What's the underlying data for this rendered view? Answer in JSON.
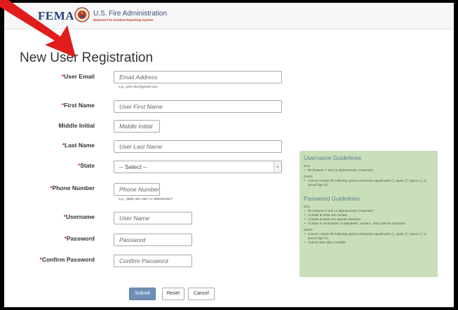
{
  "header": {
    "fema": "FEMA",
    "usfa_title": "U.S. Fire Administration",
    "usfa_sub": "National Fire Incident Reporting System"
  },
  "page_title": "New User Registration",
  "form": {
    "email": {
      "label": "User Email",
      "placeholder": "Email Address",
      "hint": "e.g., john.doe@gmail.com"
    },
    "first_name": {
      "label": "First Name",
      "placeholder": "User First Name"
    },
    "middle_initial": {
      "label": "Middle Initial",
      "placeholder": "Middle Initial"
    },
    "last_name": {
      "label": "Last Name",
      "placeholder": "User Last Name"
    },
    "state": {
      "label": "State",
      "value": "-- Select --"
    },
    "phone": {
      "label": "Phone Number",
      "placeholder": "Phone Number",
      "hint": "e.g., (888) 382-3827 or 8883823827"
    },
    "username": {
      "label": "Username",
      "placeholder": "User Name"
    },
    "password": {
      "label": "Password",
      "placeholder": "Password"
    },
    "confirm_password": {
      "label": "Confirm Password",
      "placeholder": "Confirm Password"
    },
    "required_mark": "*"
  },
  "buttons": {
    "submit": "Submit",
    "reset": "Reset",
    "cancel": "Cancel"
  },
  "guidelines": {
    "username": {
      "title": "Username Guidelines",
      "dos_label": "Do's",
      "dos": [
        "Be between 7 and 14 alphanumeric characters"
      ],
      "donts_label": "Don'ts",
      "donts": [
        "Cannot contain the following special characters apostrophe ('), quote (\"), space ( ), or pound sign (#)"
      ]
    },
    "password": {
      "title": "Password Guidelines",
      "dos_label": "Do's",
      "dos": [
        "Be between 8 and 14 alphanumeric characters",
        "Contain at least one number",
        "Contain at least one special character",
        "Contain a combination of alphabetic, numeric, AND special characters"
      ],
      "donts_label": "Don'ts",
      "donts": [
        "Cannot contain the following special characters apostrophe ('), quote (\"), space ( ), or pound sign (#)",
        "Cannot start with a number"
      ]
    }
  },
  "colors": {
    "accent": "#6f90b4",
    "required": "#c0392b",
    "guide_bg": "#c9dfba",
    "arrow": "#e01c1c"
  }
}
